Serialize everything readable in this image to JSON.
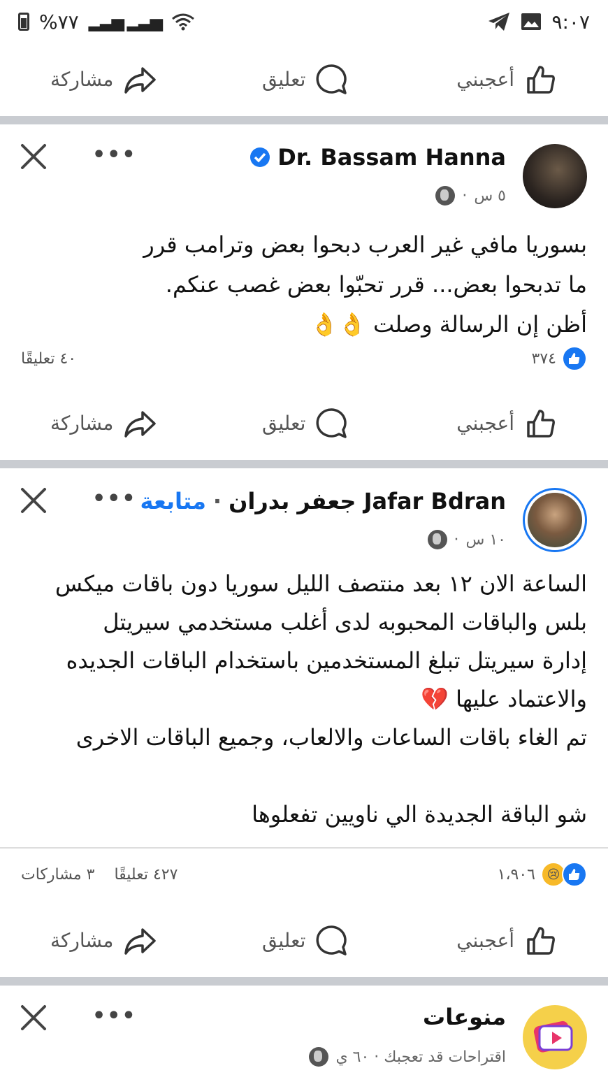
{
  "status_bar": {
    "time": "٩:٠٧",
    "battery": "%٧٧"
  },
  "actions": {
    "like": "أعجبني",
    "comment": "تعليق",
    "share": "مشاركة"
  },
  "posts": [
    {
      "author": "Dr. Bassam Hanna",
      "verified": true,
      "time": "٥ س",
      "text_lines": [
        "بسوريا مافي غير العرب دبحوا بعض وترامب قرر",
        "ما تدبحوا بعض... قرر تحبّوا بعض غصب عنكم.",
        "أظن إن الرسالة وصلت 👌👌"
      ],
      "reaction_count": "٣٧٤",
      "comments": "٤٠ تعليقًا"
    },
    {
      "author": "جعفر بدران Jafar Bdran",
      "follow": "متابعة",
      "time": "١٠ س",
      "text_lines": [
        "الساعة الان ١٢ بعد منتصف الليل سوريا دون باقات ميكس",
        "بلس والباقات المحبوبه لدى أغلب مستخدمي سيريتل",
        "إدارة سيريتل تبلغ المستخدمين باستخدام الباقات الجديده",
        "والاعتماد عليها 💔",
        "تم الغاء باقات الساعات والالعاب، وجميع الباقات الاخرى",
        "",
        "شو الباقة الجديدة الي ناويين تفعلوها"
      ],
      "reaction_count": "١،٩٠٦",
      "comments": "٤٢٧ تعليقًا",
      "shares": "٣ مشاركات"
    },
    {
      "author": "منوعات",
      "meta": "اقتراحات قد تعجبك · ٦٠ ي"
    }
  ],
  "colors": {
    "accent": "#1877f2",
    "divider": "#c9ccd1"
  }
}
